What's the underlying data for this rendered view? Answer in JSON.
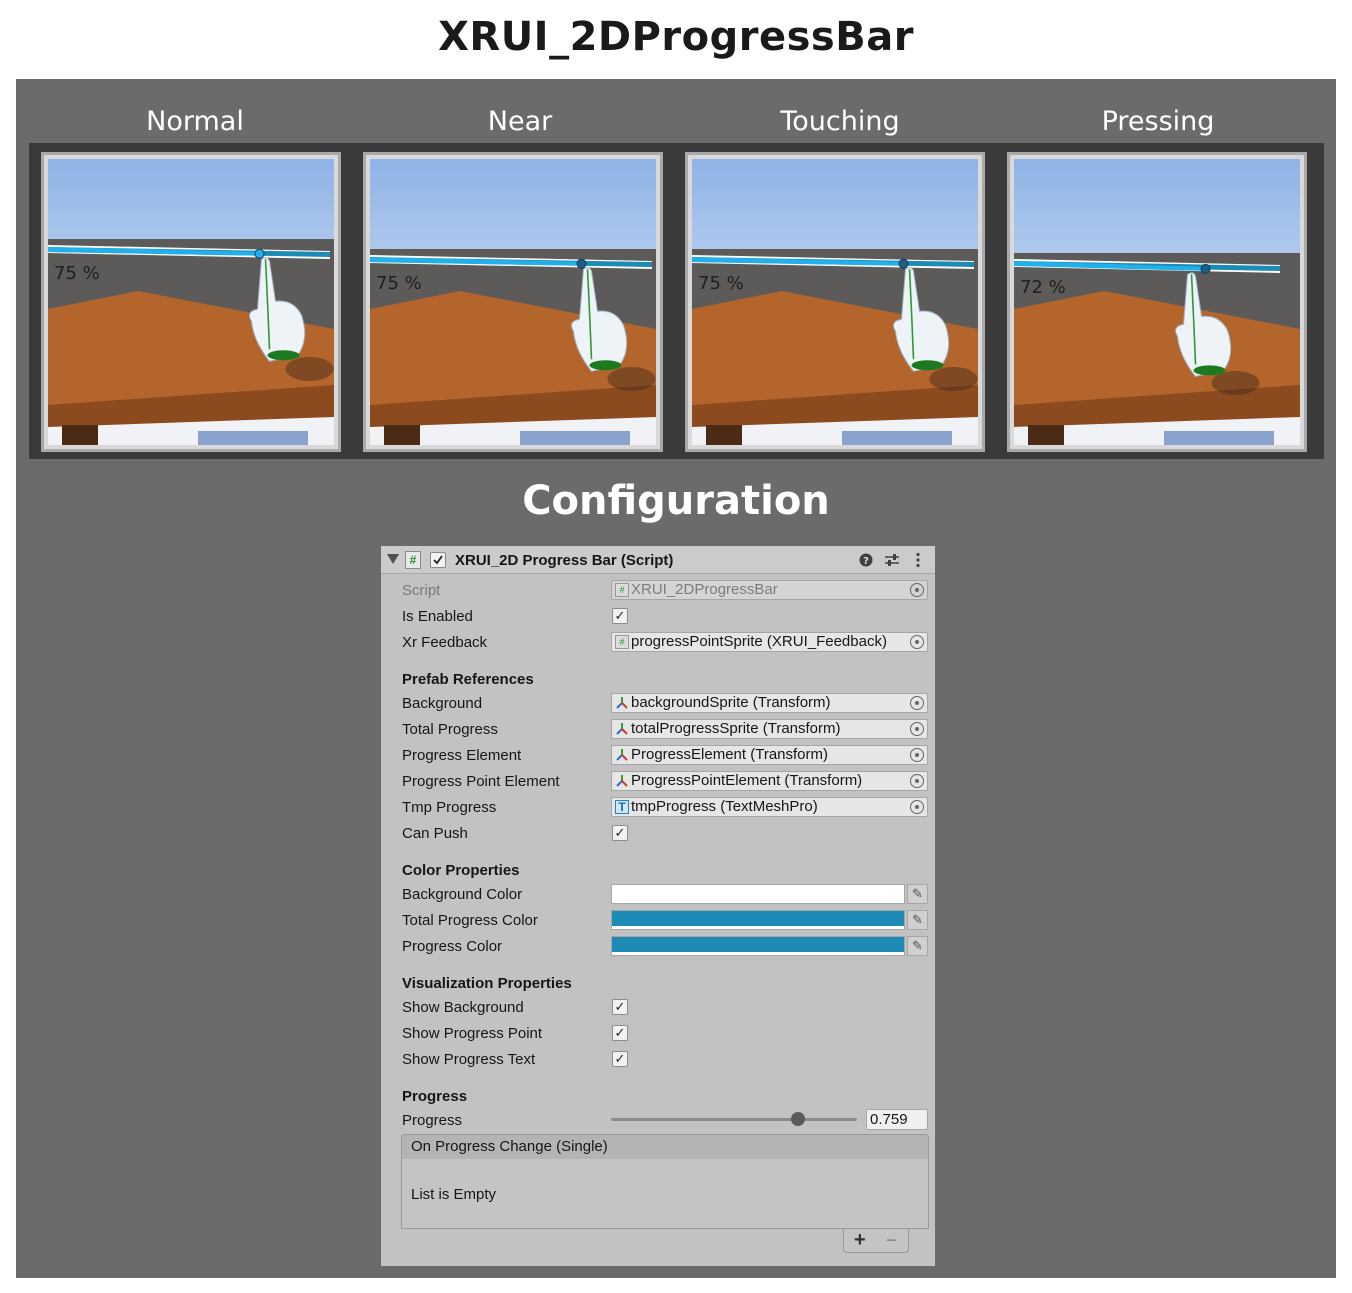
{
  "page": {
    "title": "XRUI_2DProgressBar"
  },
  "states": [
    {
      "label": "Normal",
      "percent_text": "75 %",
      "progress": 0.75
    },
    {
      "label": "Near",
      "percent_text": "75 %",
      "progress": 0.75
    },
    {
      "label": "Touching",
      "percent_text": "75 %",
      "progress": 0.75
    },
    {
      "label": "Pressing",
      "percent_text": "72 %",
      "progress": 0.72
    }
  ],
  "configuration": {
    "title": "Configuration"
  },
  "inspector": {
    "component_title": "XRUI_2D Progress Bar (Script)",
    "header_icons": [
      "help-icon",
      "presets-icon",
      "more-options-icon"
    ],
    "script": {
      "label": "Script",
      "value": "XRUI_2DProgressBar"
    },
    "is_enabled": {
      "label": "Is Enabled",
      "checked": true
    },
    "xr_feedback": {
      "label": "Xr Feedback",
      "value": "progressPointSprite (XRUI_Feedback)"
    },
    "prefab_references": {
      "header": "Prefab References",
      "background": {
        "label": "Background",
        "value": "backgroundSprite (Transform)"
      },
      "total_progress": {
        "label": "Total Progress",
        "value": "totalProgressSprite (Transform)"
      },
      "progress_element": {
        "label": "Progress Element",
        "value": "ProgressElement (Transform)"
      },
      "progress_point_element": {
        "label": "Progress Point Element",
        "value": "ProgressPointElement (Transform)"
      },
      "tmp_progress": {
        "label": "Tmp Progress",
        "value": "tmpProgress (TextMeshPro)"
      },
      "can_push": {
        "label": "Can Push",
        "checked": true
      }
    },
    "color_properties": {
      "header": "Color Properties",
      "background_color": {
        "label": "Background Color",
        "color": "#ffffff"
      },
      "total_progress_color": {
        "label": "Total Progress Color",
        "color": "#1e8ab6"
      },
      "progress_color": {
        "label": "Progress Color",
        "color": "#1e8ab6"
      }
    },
    "visualization_properties": {
      "header": "Visualization Properties",
      "show_background": {
        "label": "Show Background",
        "checked": true
      },
      "show_progress_point": {
        "label": "Show Progress Point",
        "checked": true
      },
      "show_progress_text": {
        "label": "Show Progress Text",
        "checked": true
      }
    },
    "progress_section": {
      "header": "Progress",
      "label": "Progress",
      "value_text": "0.759",
      "value": 0.759
    },
    "event": {
      "title": "On Progress Change (Single)",
      "empty_text": "List is Empty",
      "add_label": "+",
      "remove_label": "−"
    }
  }
}
